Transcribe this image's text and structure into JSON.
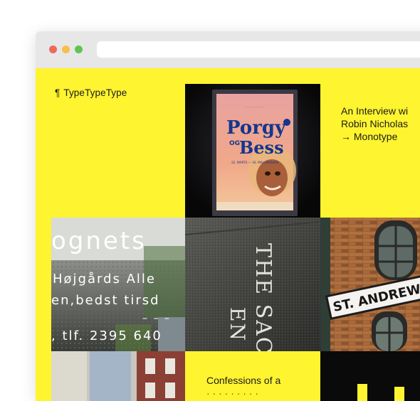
{
  "browser": {
    "buttons": [
      "close",
      "minimize",
      "zoom"
    ],
    "address": ""
  },
  "site": {
    "title": "TypeTypeType",
    "title_icon": "pilcrow-icon",
    "title_glyph": "¶"
  },
  "posts": [
    {
      "kind": "text",
      "lines": [
        "An Interview wi",
        "Robin Nicholas",
        "→ Monotype"
      ]
    },
    {
      "kind": "image",
      "subject": "Porgy og Bess poster",
      "title_top": "Porgy",
      "title_mid": "OG",
      "title_bottom": "Bess",
      "date_line": "22. MARTS — 16. MAJ OPERAEN"
    },
    {
      "kind": "image",
      "subject": "Danish shop window lettering",
      "lines": [
        "ognets",
        "Højgårds Alle",
        "en,bedst tirsd",
        "– – –",
        ", tlf. 2395 640"
      ]
    },
    {
      "kind": "image",
      "subject": "Engraved stone lettering",
      "lines": [
        "THE SACKLE",
        "EN"
      ]
    },
    {
      "kind": "image",
      "subject": "St Andrews street sign",
      "sign_text": "ST. ANDREWS W"
    },
    {
      "kind": "text",
      "lines": [
        "Confessions of a",
        "· · · · · · · · ·"
      ]
    }
  ],
  "colors": {
    "page_background": "#fef42f",
    "chrome": "#e7e7e7",
    "close": "#ed6a5e",
    "minimize": "#f5bf4f",
    "zoom": "#61c454"
  }
}
